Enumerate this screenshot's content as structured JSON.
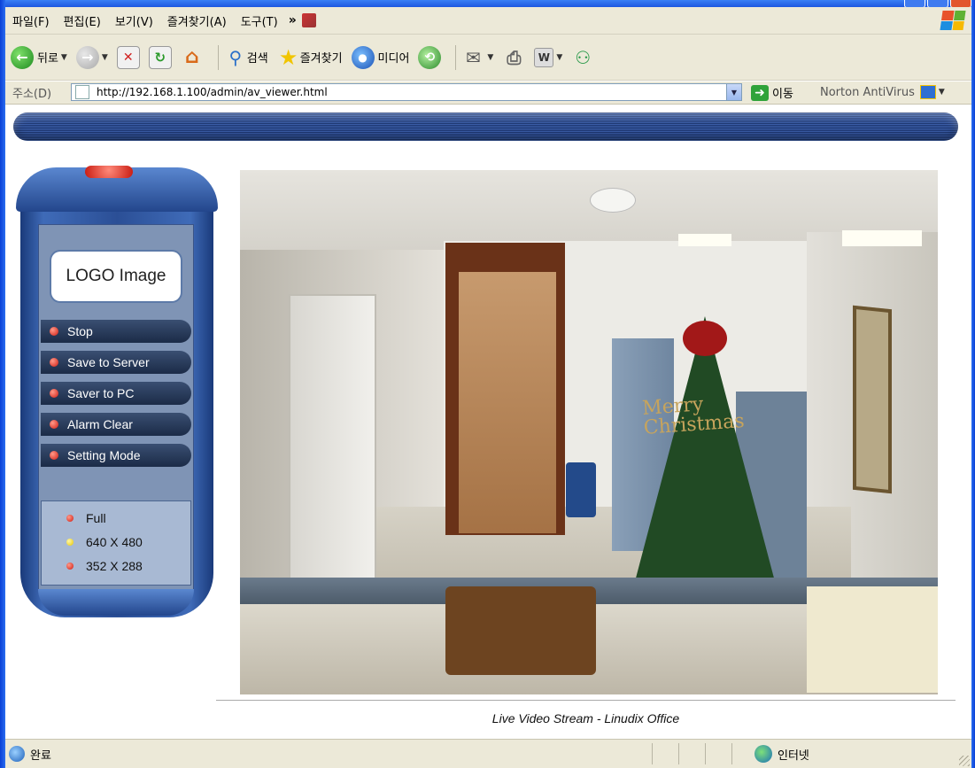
{
  "menubar": {
    "items": [
      "파일(F)",
      "편집(E)",
      "보기(V)",
      "즐겨찾기(A)",
      "도구(T)"
    ],
    "overflow": "»"
  },
  "toolbar": {
    "back_label": "뒤로",
    "search_label": "검색",
    "favorites_label": "즐겨찾기",
    "media_label": "미디어"
  },
  "addressbar": {
    "label": "주소(D)",
    "url": "http://192.168.1.100/admin/av_viewer.html",
    "go_label": "이동",
    "norton_label": "Norton AntiVirus"
  },
  "panel": {
    "logo_text": "LOGO Image",
    "buttons": [
      "Stop",
      "Save to Server",
      "Saver to PC",
      "Alarm Clear",
      "Setting Mode"
    ],
    "resolutions": [
      {
        "label": "Full",
        "color": "red"
      },
      {
        "label": "640 X 480",
        "color": "yellow"
      },
      {
        "label": "352 X 288",
        "color": "red"
      }
    ]
  },
  "video": {
    "caption": "Live Video Stream - Linudix Office",
    "sign_text_1": "Merry",
    "sign_text_2": "Christmas"
  },
  "statusbar": {
    "status_text": "완료",
    "zone_text": "인터넷"
  },
  "colors": {
    "chrome": "#ece9d8",
    "xp_blue": "#0a3fd6",
    "banner": "#2b4a8f",
    "panel_blue": "#3f6bb8"
  }
}
